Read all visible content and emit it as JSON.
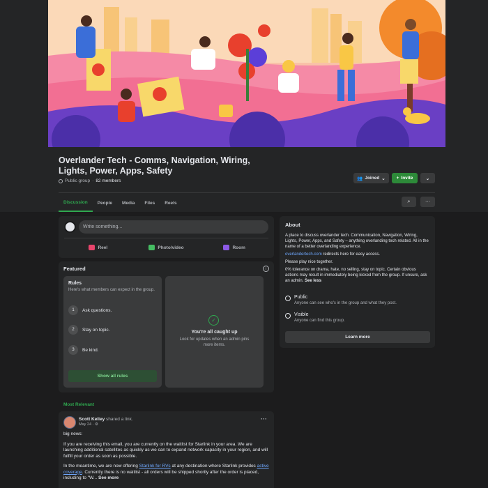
{
  "group": {
    "title": "Overlander Tech - Comms, Navigation, Wiring, Lights, Power, Apps, Safety",
    "privacy": "Public group",
    "separator": "·",
    "members": "82 members"
  },
  "header_buttons": {
    "joined": "Joined",
    "invite": "Invite",
    "more": "⌄"
  },
  "tabs": [
    "Discussion",
    "People",
    "Media",
    "Files",
    "Reels"
  ],
  "tab_actions": {
    "search": "⌕",
    "more": "···"
  },
  "composer": {
    "placeholder": "Write something...",
    "actions": [
      {
        "label": "Reel",
        "color": "#e9456c"
      },
      {
        "label": "Photo/video",
        "color": "#45bd62"
      },
      {
        "label": "Room",
        "color": "#8c5ae6"
      }
    ]
  },
  "featured": {
    "title": "Featured",
    "info": "i",
    "rules_title": "Rules",
    "rules_sub": "Here's what members can expect in the group.",
    "rules": [
      {
        "num": "1",
        "text": "Ask questions."
      },
      {
        "num": "2",
        "text": "Stay on topic."
      },
      {
        "num": "3",
        "text": "Be kind."
      }
    ],
    "all_rules": "Show all rules",
    "caught_title": "You're all caught up",
    "caught_sub": "Look for updates when an admin pins more items."
  },
  "feed": {
    "sort": "Most Relevant",
    "post": {
      "author": "Scott Kelley",
      "action": "shared a link.",
      "date": "May 24 · ",
      "more": "···",
      "p1": "big news:",
      "p2": "If you are receiving this email, you are currently on the waitlist for Starlink in your area. We are launching additional satellites as quickly as we can to expand network capacity in your region, and will fulfill your order as soon as possible.",
      "p3a": "In the meantime, we are now offering ",
      "p3link1": "Starlink for RVs",
      "p3b": " at any destination where Starlink provides ",
      "p3link2": "active coverage",
      "p3c": ". Currently there is no waitlist - all orders will be shipped shortly after the order is placed, including to \"W... ",
      "see_more": "See more"
    }
  },
  "about": {
    "title": "About",
    "desc": "A place to discuss overlander tech. Communication, Navigation, Wiring, Lights, Power, Apps, and Safety – anything overlanding tech related. All in the name of a better overlanding experience.",
    "link": "overlandertech.com",
    "link_rest": " redirects here for easy access.",
    "nice": "Please play nice together.",
    "policy": "0% tolerance on drama, hate, no selling, stay on topic. Certain obvious actions may result in immediately being kicked from the group. If unsure, ask an admin. ",
    "see_less": "See less",
    "public_title": "Public",
    "public_desc": "Anyone can see who's in the group and what they post.",
    "visible_title": "Visible",
    "visible_desc": "Anyone can find this group.",
    "learn_more": "Learn more"
  }
}
